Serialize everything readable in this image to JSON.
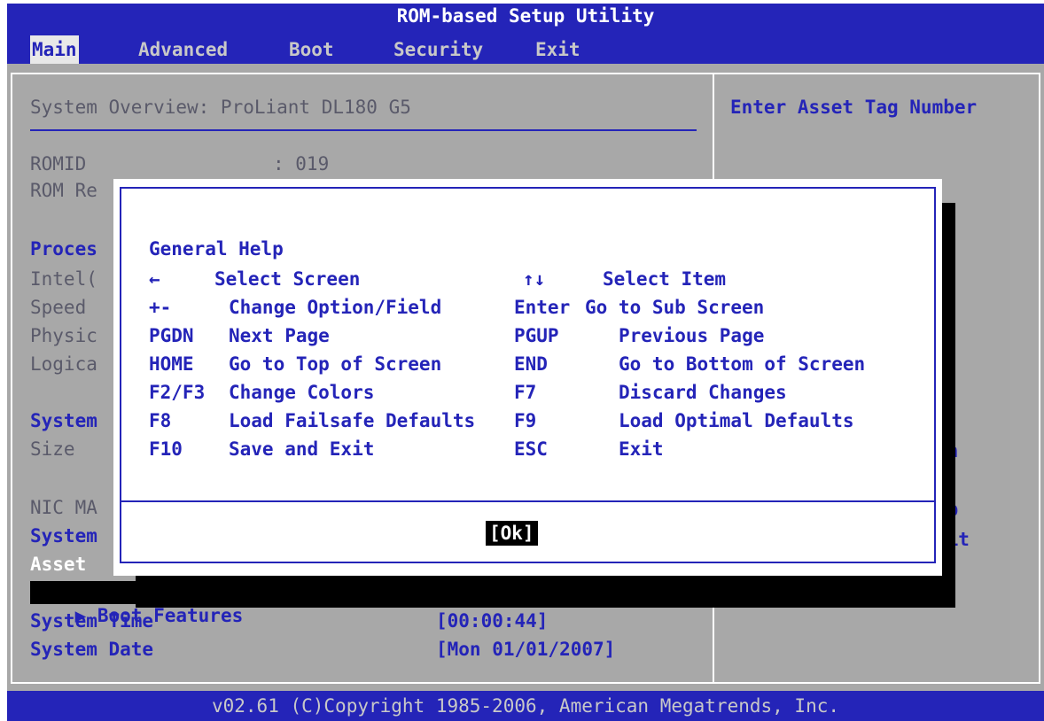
{
  "title": "ROM-based Setup Utility",
  "menu": [
    "Main",
    "Advanced",
    "Boot",
    "Security",
    "Exit"
  ],
  "main": {
    "overview": "System Overview: ProLiant DL180 G5",
    "romid_label": "ROMID",
    "romid_value": ": 019",
    "rom_rev_partial": "ROM Re",
    "processor_partial": "Proces",
    "intel_partial": "Intel(",
    "speed_partial": "Speed",
    "physical_partial": "Physic",
    "logical_partial": "Logica",
    "system_memory_partial": "System",
    "size_partial": "Size",
    "nic_partial": "NIC MA",
    "system_serial_partial": "System",
    "asset_partial": "Asset",
    "boot_features": "▶ Boot Features",
    "system_time_label": "System Time",
    "system_time_value": "[00:00:44]",
    "system_date_label": "System Date",
    "system_date_value": "[Mon 01/01/2007]"
  },
  "right_panel": {
    "help": "Enter Asset Tag Number",
    "partials": [
      "en",
      "m",
      "lp",
      "xit"
    ]
  },
  "dialog": {
    "title": "General Help",
    "rows": [
      {
        "key1": "←",
        "desc1": "Select Screen",
        "key2": "↑↓",
        "desc2": "Select Item"
      },
      {
        "key1": "+-",
        "desc1": "Change Option/Field",
        "key2": "Enter",
        "desc2": "Go to Sub Screen"
      },
      {
        "key1": "PGDN",
        "desc1": "Next Page",
        "key2": "PGUP",
        "desc2": "Previous Page"
      },
      {
        "key1": "HOME",
        "desc1": "Go to Top of Screen",
        "key2": "END",
        "desc2": "Go to Bottom of Screen"
      },
      {
        "key1": "F2/F3",
        "desc1": "Change Colors",
        "key2": "F7",
        "desc2": "Discard Changes"
      },
      {
        "key1": "F8",
        "desc1": "Load Failsafe Defaults",
        "key2": "F9",
        "desc2": "Load Optimal Defaults"
      },
      {
        "key1": "F10",
        "desc1": "Save and Exit",
        "key2": "ESC",
        "desc2": "Exit"
      }
    ],
    "ok_label": "[Ok]"
  },
  "footer": "v02.61 (C)Copyright 1985-2006, American Megatrends, Inc.",
  "colors": {
    "bios_blue": "#2424b8",
    "bios_gray": "#a8a8a8",
    "dialog_white": "#ffffff"
  }
}
